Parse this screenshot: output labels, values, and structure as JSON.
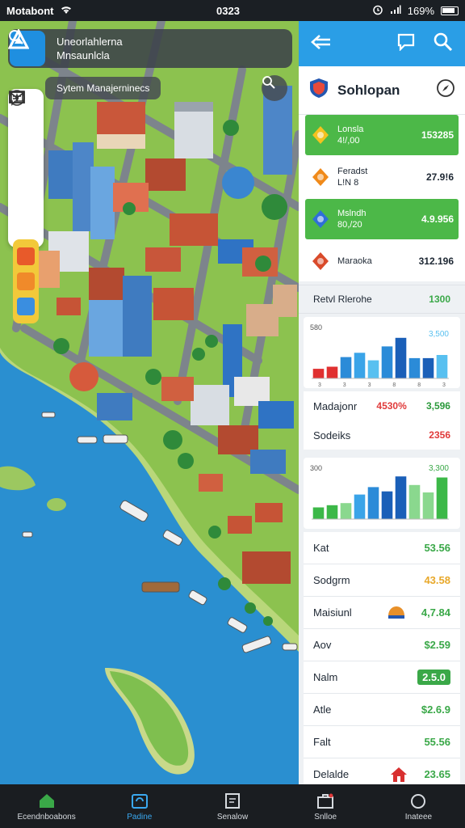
{
  "status_bar": {
    "carrier": "Motabont",
    "time": "0323",
    "battery": "169%"
  },
  "map": {
    "search_title_line1": "Uneorlahlerna",
    "search_title_line2": "Mnsaunlcla",
    "sub_search": "Sytem Manajerninecs",
    "logo_glyph": "A"
  },
  "panel": {
    "title": "Sohlopan",
    "resources": [
      {
        "name_line1": "Lonsla",
        "name_line2": "4!/,00",
        "value": "153285",
        "icon": "flame-icon",
        "color": "#f4c21f",
        "highlight": true
      },
      {
        "name_line1": "Feradst",
        "name_line2": "L!N 8",
        "value": "27.9!6",
        "icon": "gem-icon",
        "color": "#f08a1a",
        "highlight": false
      },
      {
        "name_line1": "Mslndh",
        "name_line2": "80,/20",
        "value": "4.9.956",
        "icon": "kite-icon",
        "color": "#2f6fd8",
        "highlight": true
      },
      {
        "name_line1": "Maraoka",
        "name_line2": "",
        "value": "312.196",
        "icon": "funnel-icon",
        "color": "#d94a2a",
        "highlight": false
      }
    ],
    "section_header": {
      "label": "Retvl Rlerohe",
      "value": "1300"
    },
    "chart1": {
      "top_left": "580",
      "top_right": "3,500",
      "ticks": [
        "3",
        "3",
        "3",
        "8",
        "8",
        "3"
      ]
    },
    "metrics": [
      {
        "label": "Madajonr",
        "value": "4530%",
        "color": "red"
      },
      {
        "label": "Sodeiks",
        "value": "2356",
        "color": "red"
      }
    ],
    "metric1_value_green": "3,596",
    "chart2": {
      "top_left": "300",
      "top_right": "3,300"
    },
    "stats": [
      {
        "label": "Kat",
        "value": "53.56",
        "style": "green",
        "icon": ""
      },
      {
        "label": "Sodgrm",
        "value": "43.58",
        "style": "orange",
        "icon": ""
      },
      {
        "label": "Maisiunl",
        "value": "4,7.84",
        "style": "green",
        "icon": "helmet-icon"
      },
      {
        "label": "Aov",
        "value": "$2.59",
        "style": "green",
        "icon": ""
      },
      {
        "label": "Nalm",
        "value": "2.5.0",
        "style": "badge",
        "icon": ""
      },
      {
        "label": "Atle",
        "value": "$2.6.9",
        "style": "green",
        "icon": ""
      },
      {
        "label": "Falt",
        "value": "55.56",
        "style": "green",
        "icon": ""
      },
      {
        "label": "Delalde",
        "value": "23.65",
        "style": "green",
        "icon": "house-icon"
      }
    ]
  },
  "chart_data": [
    {
      "type": "bar",
      "categories": [
        "1",
        "2",
        "3",
        "4",
        "5",
        "6",
        "7",
        "8",
        "9",
        "10"
      ],
      "values": [
        18,
        22,
        40,
        48,
        34,
        60,
        76,
        38,
        38,
        44
      ],
      "colors": [
        "#e03030",
        "#e03030",
        "#2b8bd8",
        "#3aa4e8",
        "#58c0f0",
        "#2b8bd8",
        "#1a5fb8",
        "#2b8bd8",
        "#1a5fb8",
        "#58c0f0"
      ],
      "ylim": [
        0,
        100
      ]
    },
    {
      "type": "bar",
      "categories": [
        "1",
        "2",
        "3",
        "4",
        "5",
        "6",
        "7",
        "8",
        "9",
        "10"
      ],
      "values": [
        22,
        26,
        30,
        46,
        60,
        52,
        80,
        64,
        50,
        78
      ],
      "colors": [
        "#3cb848",
        "#3cb848",
        "#8ad88e",
        "#3aa4e8",
        "#2b8bd8",
        "#1a5fb8",
        "#1a5fb8",
        "#8ad88e",
        "#8ad88e",
        "#3cb848"
      ],
      "ylim": [
        0,
        100
      ]
    }
  ],
  "bottom_nav": [
    {
      "label": "Ecendnboabons",
      "icon": "home-icon",
      "active": false
    },
    {
      "label": "Padine",
      "icon": "calendar-icon",
      "active": true
    },
    {
      "label": "Senalow",
      "icon": "document-icon",
      "active": false
    },
    {
      "label": "Snlloe",
      "icon": "briefcase-icon",
      "active": false
    },
    {
      "label": "Inateee",
      "icon": "circle-icon",
      "active": false
    }
  ]
}
